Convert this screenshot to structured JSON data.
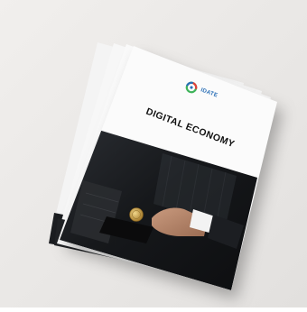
{
  "cover": {
    "brand": "IDATE",
    "title": "DIGITAL ECONOMY"
  },
  "colors": {
    "background": "#ececea",
    "cover_white": "#fbfbfb",
    "photo_dark": "#1a1c1f",
    "brand_blue": "#2a6fb6",
    "logo_green": "#3fb35a",
    "logo_red": "#e2403a",
    "coin_gold": "#c9a24a"
  },
  "icons": {
    "logo": "idate-logo-icon"
  }
}
